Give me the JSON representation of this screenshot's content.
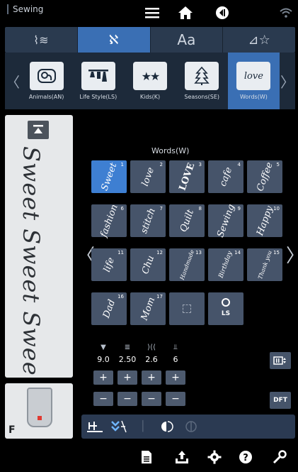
{
  "status_bar": {
    "mode_label": "Sewing",
    "icons": [
      "menu-icon",
      "home-icon",
      "back-icon",
      "wifi-icon"
    ]
  },
  "category_tabs": [
    {
      "icon": "utility-stitch-icon",
      "glyph": "⫶"
    },
    {
      "icon": "decorative-stitch-icon",
      "glyph": "⚭",
      "active": true
    },
    {
      "icon": "alphabet-icon",
      "glyph": "Aa"
    },
    {
      "icon": "my-design-icon",
      "glyph": "☆"
    }
  ],
  "sub_categories": [
    {
      "label": "Animals(AN)",
      "icon": "elephant-icon",
      "glyph": "🐘"
    },
    {
      "label": "Life Style(LS)",
      "icon": "clothes-rack-icon",
      "glyph": "👕"
    },
    {
      "label": "Kids(K)",
      "icon": "stars-icon",
      "glyph": "★★"
    },
    {
      "label": "Seasons(SE)",
      "icon": "tree-icon",
      "glyph": "🎄"
    },
    {
      "label": "Words(W)",
      "icon": "love-word-icon",
      "glyph": "love",
      "active": true
    }
  ],
  "preview": {
    "script_text": "Sweet Sweet Sweet Sweet Su"
  },
  "presser_foot": {
    "letter": "F"
  },
  "grid": {
    "title": "Words(W)",
    "items": [
      {
        "num": "1",
        "word": "Sweet",
        "active": true
      },
      {
        "num": "2",
        "word": "love"
      },
      {
        "num": "3",
        "word": "LOVE"
      },
      {
        "num": "4",
        "word": "cafe"
      },
      {
        "num": "5",
        "word": "Coffee"
      },
      {
        "num": "6",
        "word": "fashion"
      },
      {
        "num": "7",
        "word": "stitch"
      },
      {
        "num": "8",
        "word": "Quilt"
      },
      {
        "num": "9",
        "word": "Sewing"
      },
      {
        "num": "10",
        "word": "Happy"
      },
      {
        "num": "11",
        "word": "life"
      },
      {
        "num": "12",
        "word": "Chu"
      },
      {
        "num": "13",
        "word": "Handmade"
      },
      {
        "num": "14",
        "word": "Birthday"
      },
      {
        "num": "15",
        "word": "Thank you"
      },
      {
        "num": "16",
        "word": "Dad"
      },
      {
        "num": "17",
        "word": "Mom"
      }
    ],
    "ls_label": "LS"
  },
  "settings": {
    "values": [
      "9.0",
      "2.50",
      "2.6",
      "6"
    ],
    "icons": [
      "stitch-width-icon",
      "stitch-length-icon",
      "tension-icon",
      "density-icon"
    ],
    "plus": "+",
    "minus": "−"
  },
  "side_buttons": {
    "dft": "DFT"
  },
  "toolbar": {
    "icons": [
      "needle-position-icon",
      "reinforcement-icon",
      "mirror-icon",
      "color-icon"
    ]
  },
  "bottom_nav": {
    "icons": [
      "memory-icon",
      "transfer-icon",
      "settings-icon",
      "help-icon",
      "wrench-icon"
    ]
  }
}
